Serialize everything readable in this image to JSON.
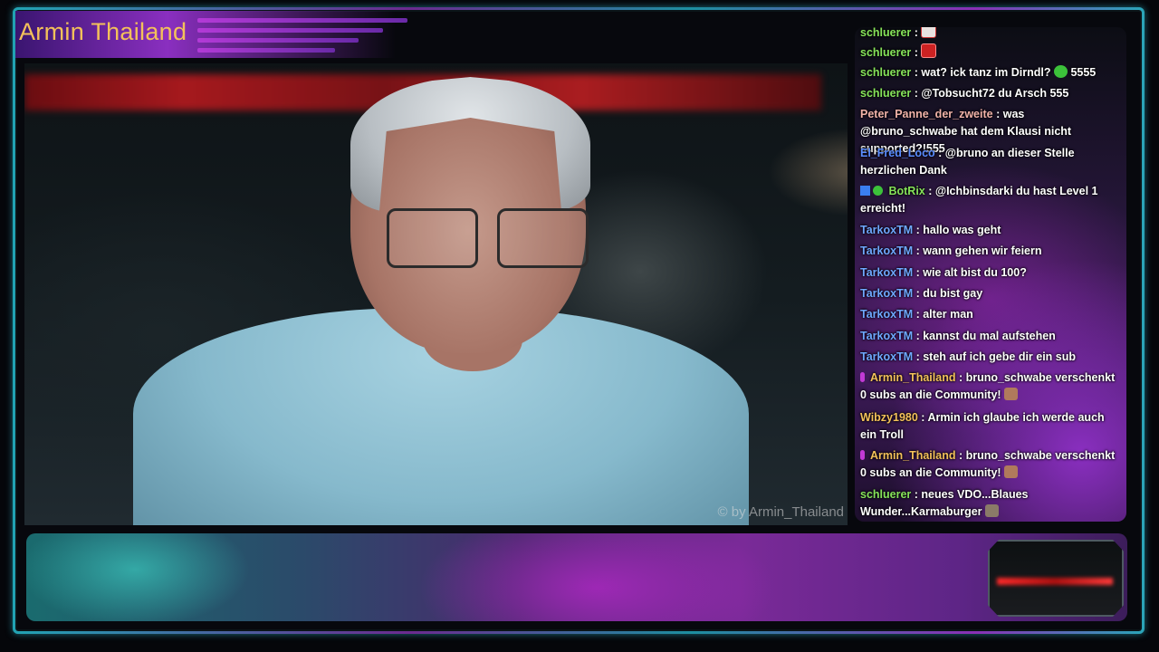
{
  "stream": {
    "title": "Armin Thailand",
    "watermark": "© by Armin_Thailand"
  },
  "colors": {
    "title_text": "#f3c15a",
    "accent_purple": "#8a2fc0",
    "frame_teal": "#2a8ea0"
  },
  "chat": {
    "messages": [
      {
        "user": "schluerer",
        "color": "#86e35a",
        "text": "",
        "emote": "red-box-emote"
      },
      {
        "user": "schluerer",
        "color": "#86e35a",
        "text": "",
        "emote": "red-box-emote"
      },
      {
        "user": "schluerer",
        "color": "#86e35a",
        "text": "wat? ick tanz im Dirndl?",
        "emote": "green-blob-emote",
        "suffix": "5555"
      },
      {
        "user": "schluerer",
        "color": "#86e35a",
        "text": "@Tobsucht72 du Arsch 555"
      },
      {
        "user": "Peter_Panne_der_zweite",
        "color": "#f0b2a8",
        "text": "was @bruno_schwabe hat dem Klausi nicht supported?!555"
      },
      {
        "user": "El_Fred_Loco",
        "color": "#5a8cff",
        "text": "@bruno an dieser Stelle herzlichen Dank"
      },
      {
        "user": "BotRix",
        "color": "#86e35a",
        "text": "@Ichbinsdarki du hast Level 1 erreicht!",
        "badges": true
      },
      {
        "user": "TarkoxTM",
        "color": "#6fa8ff",
        "text": "hallo was geht"
      },
      {
        "user": "TarkoxTM",
        "color": "#6fa8ff",
        "text": "wann gehen wir feiern"
      },
      {
        "user": "TarkoxTM",
        "color": "#6fa8ff",
        "text": "wie alt bist du 100?"
      },
      {
        "user": "TarkoxTM",
        "color": "#6fa8ff",
        "text": "du bist gay"
      },
      {
        "user": "TarkoxTM",
        "color": "#6fa8ff",
        "text": "alter man"
      },
      {
        "user": "TarkoxTM",
        "color": "#6fa8ff",
        "text": "kannst du mal aufstehen"
      },
      {
        "user": "TarkoxTM",
        "color": "#6fa8ff",
        "text": "steh auf ich gebe dir ein sub"
      },
      {
        "user": "Armin_Thailand",
        "color": "#f3c15a",
        "text": "bruno_schwabe verschenkt 0 subs an die Community!",
        "emote": "face-emote",
        "badges": true
      },
      {
        "user": "Wibzy1980",
        "color": "#f3c15a",
        "text": "Armin ich glaube ich werde auch ein Troll"
      },
      {
        "user": "Armin_Thailand",
        "color": "#f3c15a",
        "text": "bruno_schwabe verschenkt 0 subs an die Community!",
        "emote": "face-emote",
        "badges": true
      },
      {
        "user": "schluerer",
        "color": "#86e35a",
        "text": "neues VDO...Blaues Wunder...Karmaburger",
        "emote": "burger-emote"
      }
    ]
  }
}
